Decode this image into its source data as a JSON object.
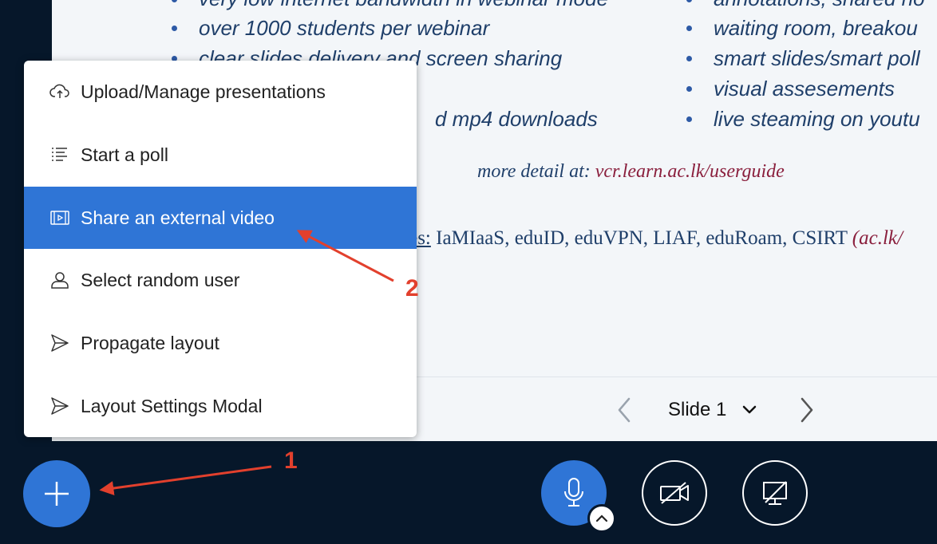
{
  "slide": {
    "left_bullets": [
      "very low internet bandwidth in webinar mode",
      "over 1000 students per webinar",
      "clear slides delivery and screen sharing",
      "",
      "d mp4 downloads"
    ],
    "right_bullets": [
      "annotations, shared no",
      "waiting room, breakou",
      "smart slides/smart poll",
      "visual assesements",
      "live steaming on youtu"
    ],
    "detail_prefix": "more detail at:",
    "detail_link": "vcr.learn.ac.lk/userguide",
    "services_label": "ces:",
    "services_text": " IaMIaaS, eduID, eduVPN, LIAF, eduRoam, CSIRT ",
    "services_link": "(ac.lk/"
  },
  "slide_nav": {
    "current": "Slide 1"
  },
  "menu": {
    "items": [
      {
        "label": "Upload/Manage presentations",
        "icon": "upload-cloud-icon"
      },
      {
        "label": "Start a poll",
        "icon": "poll-list-icon"
      },
      {
        "label": "Share an external video",
        "icon": "external-video-icon",
        "active": true
      },
      {
        "label": "Select random user",
        "icon": "user-icon"
      },
      {
        "label": "Propagate layout",
        "icon": "send-icon"
      },
      {
        "label": "Layout Settings Modal",
        "icon": "send-icon"
      }
    ]
  },
  "annotations": {
    "one": "1",
    "two": "2",
    "color": "#e2402d"
  },
  "colors": {
    "accent": "#2f75d6",
    "background": "#06172a",
    "slide_bg": "#f3f6f9"
  }
}
